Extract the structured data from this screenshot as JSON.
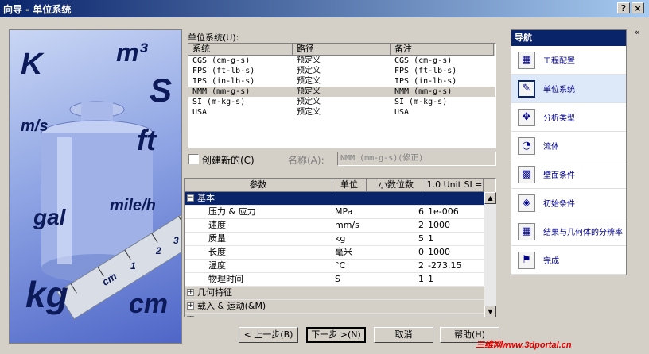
{
  "window": {
    "title": "向导 - 单位系统",
    "help_btn": "?",
    "close_btn": "×"
  },
  "hero_units": [
    "K",
    "m³",
    "S",
    "m/s",
    "ft",
    "gal",
    "mile/h",
    "kg",
    "cm",
    "cm",
    "1",
    "2",
    "3"
  ],
  "units_list": {
    "label": "单位系统(U):",
    "headers": [
      "系统",
      "路径",
      "备注"
    ],
    "rows": [
      [
        "CGS (cm-g-s)",
        "预定义",
        "CGS (cm-g-s)"
      ],
      [
        "FPS (ft-lb-s)",
        "预定义",
        "FPS (ft-lb-s)"
      ],
      [
        "IPS (in-lb-s)",
        "预定义",
        "IPS (in-lb-s)"
      ],
      [
        "NMM (mm-g-s)",
        "预定义",
        "NMM (mm-g-s)"
      ],
      [
        "SI (m-kg-s)",
        "预定义",
        "SI (m-kg-s)"
      ],
      [
        "USA",
        "预定义",
        "USA"
      ]
    ],
    "selected_index": 3
  },
  "create_new": {
    "label": "创建新的(C)",
    "checked": false
  },
  "name_field": {
    "label": "名称(A):",
    "value": "NMM (mm-g-s)(修正)"
  },
  "grid": {
    "headers": [
      "参数",
      "单位",
      "小数位数",
      "1.0 Unit SI ="
    ],
    "group_basic": "基本",
    "rows": [
      [
        "压力 & 应力",
        "MPa",
        "6",
        "1e-006"
      ],
      [
        "速度",
        "mm/s",
        "2",
        "1000"
      ],
      [
        "质量",
        "kg",
        "5",
        "1"
      ],
      [
        "长度",
        "毫米",
        "0",
        "1000"
      ],
      [
        "温度",
        "°C",
        "2",
        "-273.15"
      ],
      [
        "物理时间",
        "S",
        "1",
        "1"
      ]
    ],
    "group_geometry": "几何特征",
    "group_loads": "载入 & 运动(&M)",
    "group_partial": "..."
  },
  "buttons": {
    "back": "< 上一步(B)",
    "next": "下一步 >(N)",
    "cancel": "取消",
    "help": "帮助(H)"
  },
  "nav": {
    "header": "导航",
    "collapse": "«",
    "items": [
      {
        "label": "工程配置",
        "icon": "▦"
      },
      {
        "label": "单位系统",
        "icon": "✎"
      },
      {
        "label": "分析类型",
        "icon": "✥"
      },
      {
        "label": "流体",
        "icon": "◔"
      },
      {
        "label": "壁面条件",
        "icon": "▩"
      },
      {
        "label": "初始条件",
        "icon": "◈"
      },
      {
        "label": "结果与几何体的分辨率",
        "icon": "▦"
      },
      {
        "label": "完成",
        "icon": "⚑"
      }
    ],
    "active_index": 1
  },
  "watermark": "三维网www.3dportal.cn"
}
